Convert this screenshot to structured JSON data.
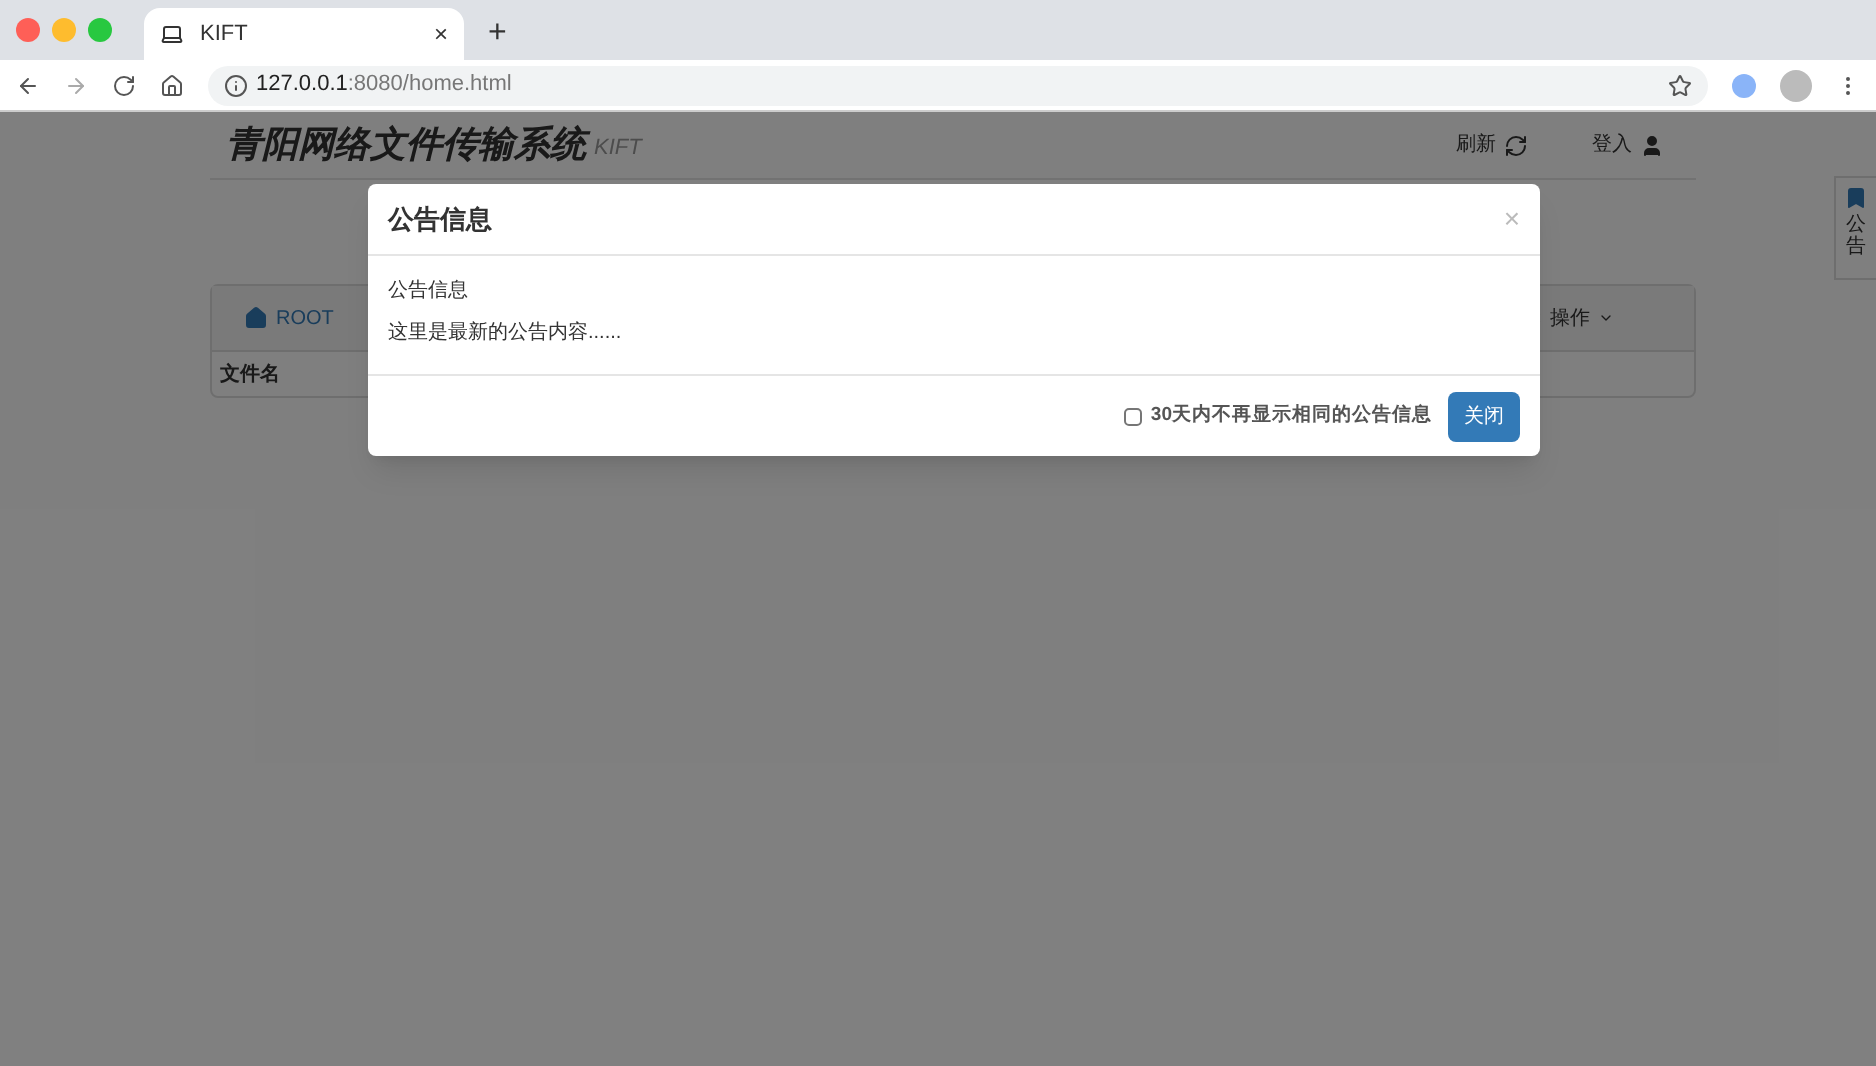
{
  "browser": {
    "tab": {
      "title": "KIFT",
      "close": "×"
    },
    "new_tab": "+",
    "url": {
      "host": "127.0.0.1",
      "rest": ":8080/home.html"
    }
  },
  "page": {
    "title": "青阳网络文件传输系统",
    "subtitle": "KIFT",
    "nav": [
      {
        "label": "刷新",
        "kind": "refresh"
      },
      {
        "label": "登入",
        "kind": "login"
      }
    ],
    "file_panel": {
      "path": "ROOT",
      "menu": "操作",
      "columns": [
        "文件名"
      ]
    },
    "notice_tab": "公告"
  },
  "modal": {
    "title": "公告信息",
    "close": "×",
    "body": [
      "公告信息",
      "这里是最新的公告内容......"
    ],
    "checkbox": {
      "label": "30天内不再显示相同的公告信息",
      "checked": false
    },
    "button": "关闭"
  }
}
